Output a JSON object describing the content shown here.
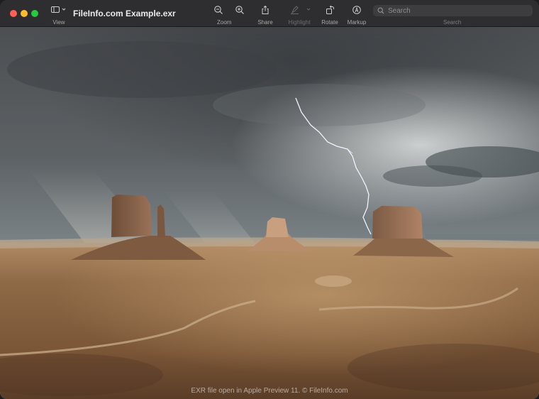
{
  "window": {
    "title": "FileInfo.com Example.exr"
  },
  "toolbar": {
    "view_label": "View",
    "zoom_label": "Zoom",
    "share_label": "Share",
    "highlight_label": "Highlight",
    "rotate_label": "Rotate",
    "markup_label": "Markup",
    "search_placeholder": "Search",
    "search_label": "Search"
  },
  "document": {
    "caption": "EXR file open in Apple Preview 11. © FileInfo.com"
  },
  "colors": {
    "toolbar_bg": "#2e2d2f",
    "close": "#ff5f57",
    "minimize": "#febc2e",
    "maximize": "#28c840"
  }
}
